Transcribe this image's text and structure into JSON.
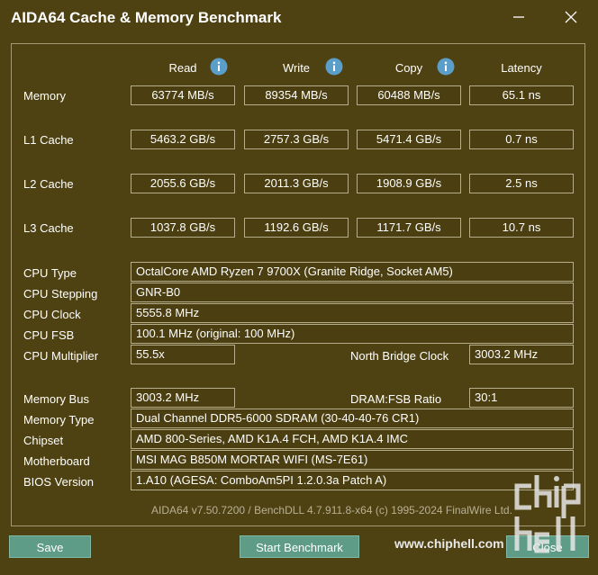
{
  "window": {
    "title": "AIDA64 Cache & Memory Benchmark"
  },
  "columns": {
    "read": "Read",
    "write": "Write",
    "copy": "Copy",
    "latency": "Latency"
  },
  "rows": {
    "memory": {
      "label": "Memory",
      "read": "63774 MB/s",
      "write": "89354 MB/s",
      "copy": "60488 MB/s",
      "latency": "65.1 ns"
    },
    "l1": {
      "label": "L1 Cache",
      "read": "5463.2 GB/s",
      "write": "2757.3 GB/s",
      "copy": "5471.4 GB/s",
      "latency": "0.7 ns"
    },
    "l2": {
      "label": "L2 Cache",
      "read": "2055.6 GB/s",
      "write": "2011.3 GB/s",
      "copy": "1908.9 GB/s",
      "latency": "2.5 ns"
    },
    "l3": {
      "label": "L3 Cache",
      "read": "1037.8 GB/s",
      "write": "1192.6 GB/s",
      "copy": "1171.7 GB/s",
      "latency": "10.7 ns"
    }
  },
  "info": {
    "cpu_type": {
      "label": "CPU Type",
      "value": "OctalCore AMD Ryzen 7 9700X  (Granite Ridge, Socket AM5)"
    },
    "cpu_stepping": {
      "label": "CPU Stepping",
      "value": "GNR-B0"
    },
    "cpu_clock": {
      "label": "CPU Clock",
      "value": "5555.8 MHz"
    },
    "cpu_fsb": {
      "label": "CPU FSB",
      "value": "100.1 MHz  (original: 100 MHz)"
    },
    "cpu_multiplier": {
      "label": "CPU Multiplier",
      "value": "55.5x"
    },
    "nb_clock": {
      "label": "North Bridge Clock",
      "value": "3003.2 MHz"
    },
    "memory_bus": {
      "label": "Memory Bus",
      "value": "3003.2 MHz"
    },
    "dram_fsb": {
      "label": "DRAM:FSB Ratio",
      "value": "30:1"
    },
    "memory_type": {
      "label": "Memory Type",
      "value": "Dual Channel DDR5-6000 SDRAM  (30-40-40-76 CR1)"
    },
    "chipset": {
      "label": "Chipset",
      "value": "AMD 800-Series, AMD K1A.4 FCH, AMD K1A.4 IMC"
    },
    "motherboard": {
      "label": "Motherboard",
      "value": "MSI MAG B850M MORTAR WIFI (MS-7E61)"
    },
    "bios": {
      "label": "BIOS Version",
      "value": "1.A10  (AGESA: ComboAm5PI 1.2.0.3a Patch A)"
    }
  },
  "footer": {
    "version_text": "AIDA64 v7.50.7200 / BenchDLL 4.7.911.8-x64  (c) 1995-2024 FinalWire Ltd."
  },
  "buttons": {
    "save": "Save",
    "start": "Start Benchmark",
    "close": "Close"
  },
  "watermark": {
    "url": "www.chiphell.com",
    "logo_text": "chip hell"
  }
}
